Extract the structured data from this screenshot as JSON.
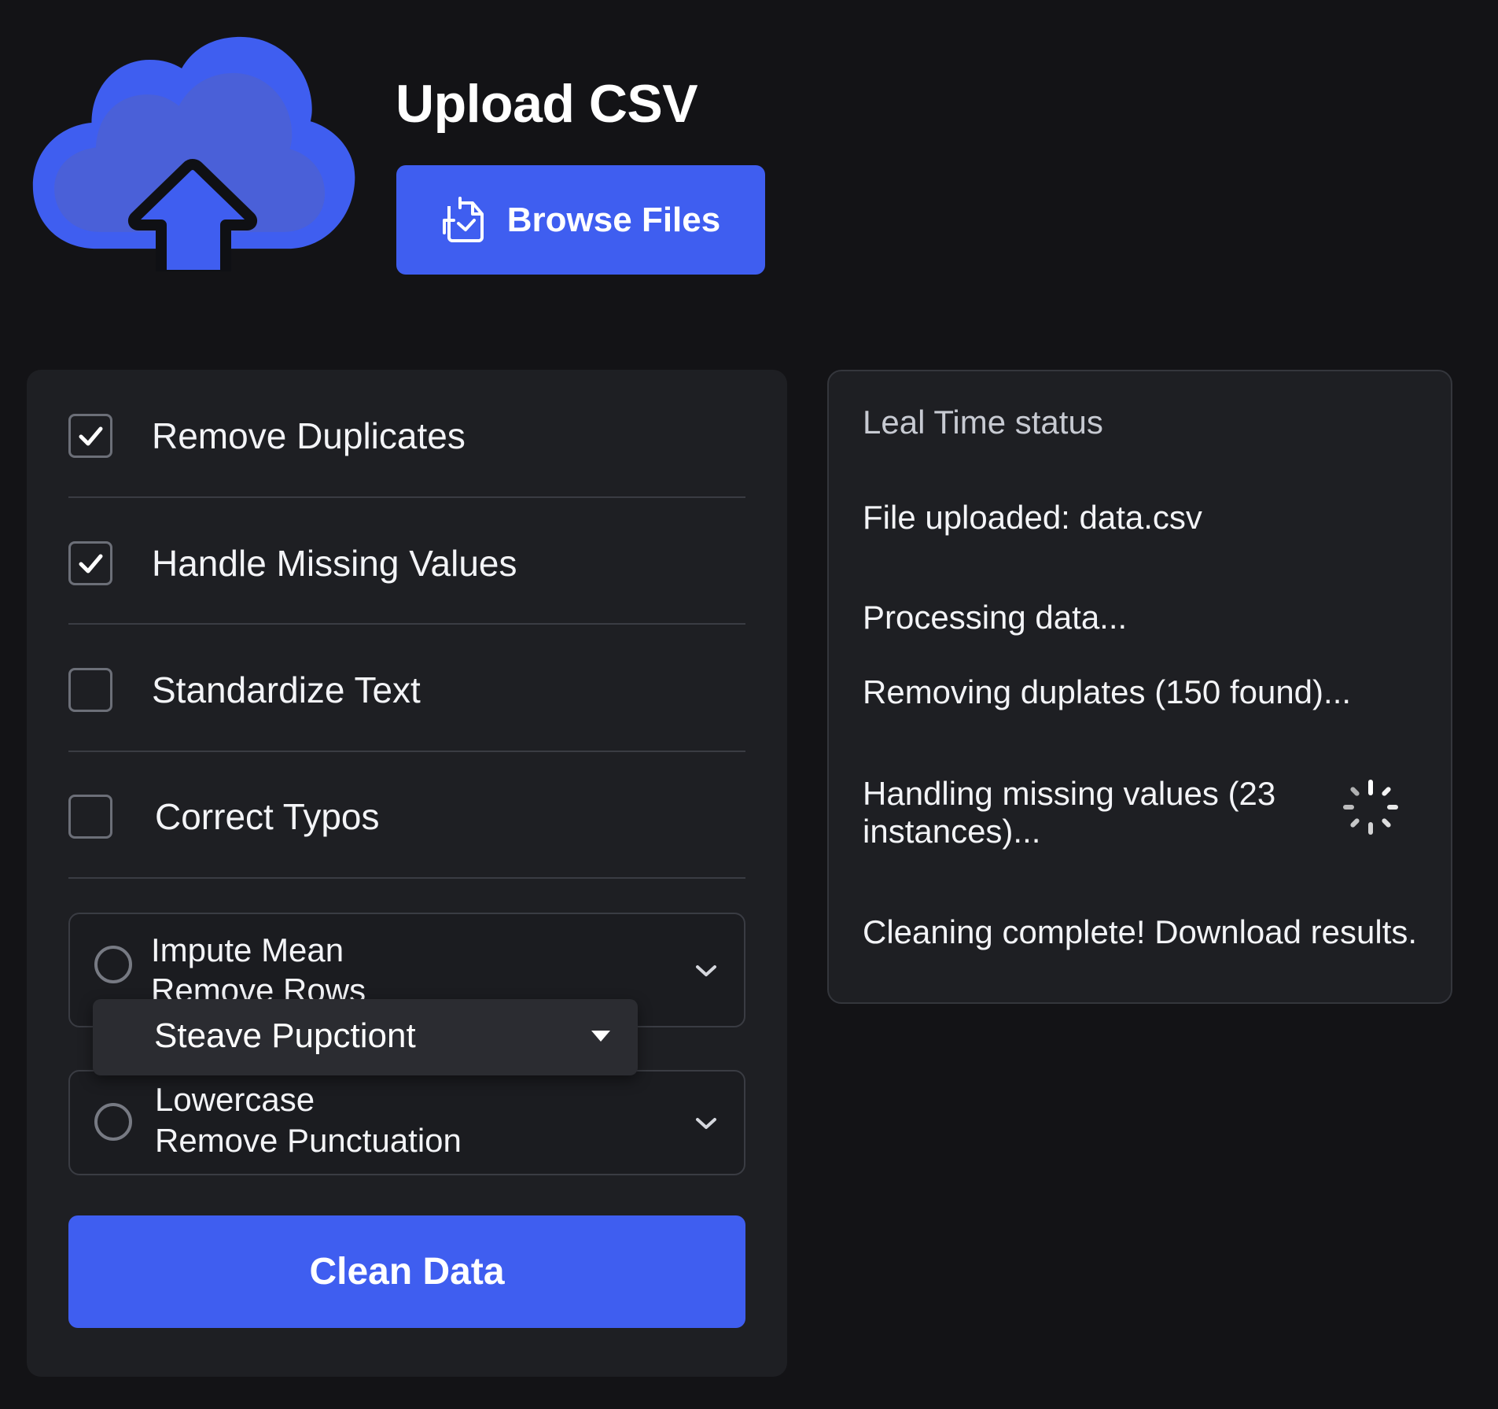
{
  "header": {
    "title": "Upload CSV",
    "browse_label": "Browse Files",
    "upload_icon": "cloud-upload-icon",
    "browse_icon": "file-upload-icon"
  },
  "options": {
    "checkboxes": [
      {
        "label": "Remove Duplicates",
        "checked": true
      },
      {
        "label": "Handle Missing Values",
        "checked": true
      },
      {
        "label": "Standardize Text",
        "checked": false
      },
      {
        "label": "Correct Typos",
        "checked": false
      }
    ],
    "missing_values_select": {
      "line1": "Impute Mean",
      "line2": "Remove Rows"
    },
    "dropdown_popup": {
      "label": "Steave Pupctiont"
    },
    "text_select": {
      "line1": "Lowercase",
      "line2": "Remove Punctuation"
    },
    "clean_label": "Clean Data"
  },
  "status": {
    "heading": "Leal Time status",
    "lines": [
      "File uploaded: data.csv",
      "Processing data...",
      "Removing duplates (150 found)...",
      "Handling missing values (23",
      "instances)...",
      "Cleaning complete! Download results."
    ]
  },
  "colors": {
    "accent": "#3f5ef0",
    "background": "#131316",
    "panel": "#1e1f23"
  }
}
